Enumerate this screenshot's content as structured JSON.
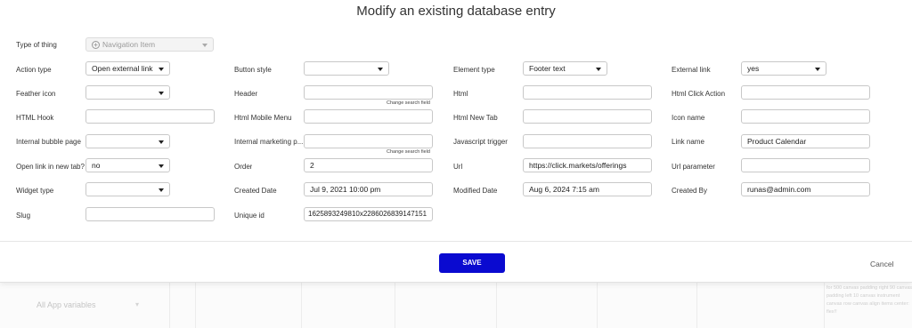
{
  "modal": {
    "title": "Modify an existing database entry",
    "change_search_field": "Change search field",
    "save_label": "SAVE",
    "cancel_label": "Cancel"
  },
  "fields": {
    "type_of_thing": {
      "label": "Type of thing",
      "placeholder": "Navigation Item"
    },
    "action_type": {
      "label": "Action type",
      "value": "Open external link"
    },
    "button_style": {
      "label": "Button style",
      "value": ""
    },
    "element_type": {
      "label": "Element type",
      "value": "Footer text"
    },
    "external_link": {
      "label": "External link",
      "value": "yes"
    },
    "feather_icon": {
      "label": "Feather icon",
      "value": ""
    },
    "header": {
      "label": "Header",
      "value": ""
    },
    "html": {
      "label": "Html",
      "value": ""
    },
    "html_click_action": {
      "label": "Html Click Action",
      "value": ""
    },
    "html_hook": {
      "label": "HTML Hook",
      "value": ""
    },
    "html_mobile_menu": {
      "label": "Html Mobile Menu",
      "value": ""
    },
    "html_new_tab": {
      "label": "Html New Tab",
      "value": ""
    },
    "icon_name": {
      "label": "Icon name",
      "value": ""
    },
    "internal_bubble_page": {
      "label": "Internal bubble page",
      "value": ""
    },
    "internal_marketing_page": {
      "label": "Internal marketing p...",
      "value": ""
    },
    "javascript_trigger": {
      "label": "Javascript trigger",
      "value": ""
    },
    "link_name": {
      "label": "Link name",
      "value": "Product Calendar"
    },
    "open_link_in_new_tab": {
      "label": "Open link in new tab?",
      "value": "no"
    },
    "order": {
      "label": "Order",
      "value": "2"
    },
    "url": {
      "label": "Url",
      "value": "https://click.markets/offerings"
    },
    "url_parameter": {
      "label": "Url parameter",
      "value": ""
    },
    "widget_type": {
      "label": "Widget type",
      "value": ""
    },
    "created_date": {
      "label": "Created Date",
      "value": "Jul 9, 2021 10:00 pm"
    },
    "modified_date": {
      "label": "Modified Date",
      "value": "Aug 6, 2024 7:15 am"
    },
    "created_by": {
      "label": "Created By",
      "value": "runas@admin.com"
    },
    "slug": {
      "label": "Slug",
      "value": ""
    },
    "unique_id": {
      "label": "Unique id",
      "value": "1625893249810x2286026839147151"
    }
  },
  "background": {
    "left_label": "All App variables",
    "right_text": "for 500 canvas padding right 90 canvas padding left 10 canvas instrument canvas row canvas align items center: flex!!"
  },
  "colors": {
    "save_button": "#0a0ad0"
  },
  "icons": {
    "plus": "plus-circle-icon",
    "dropdown": "chevron-down-icon"
  }
}
